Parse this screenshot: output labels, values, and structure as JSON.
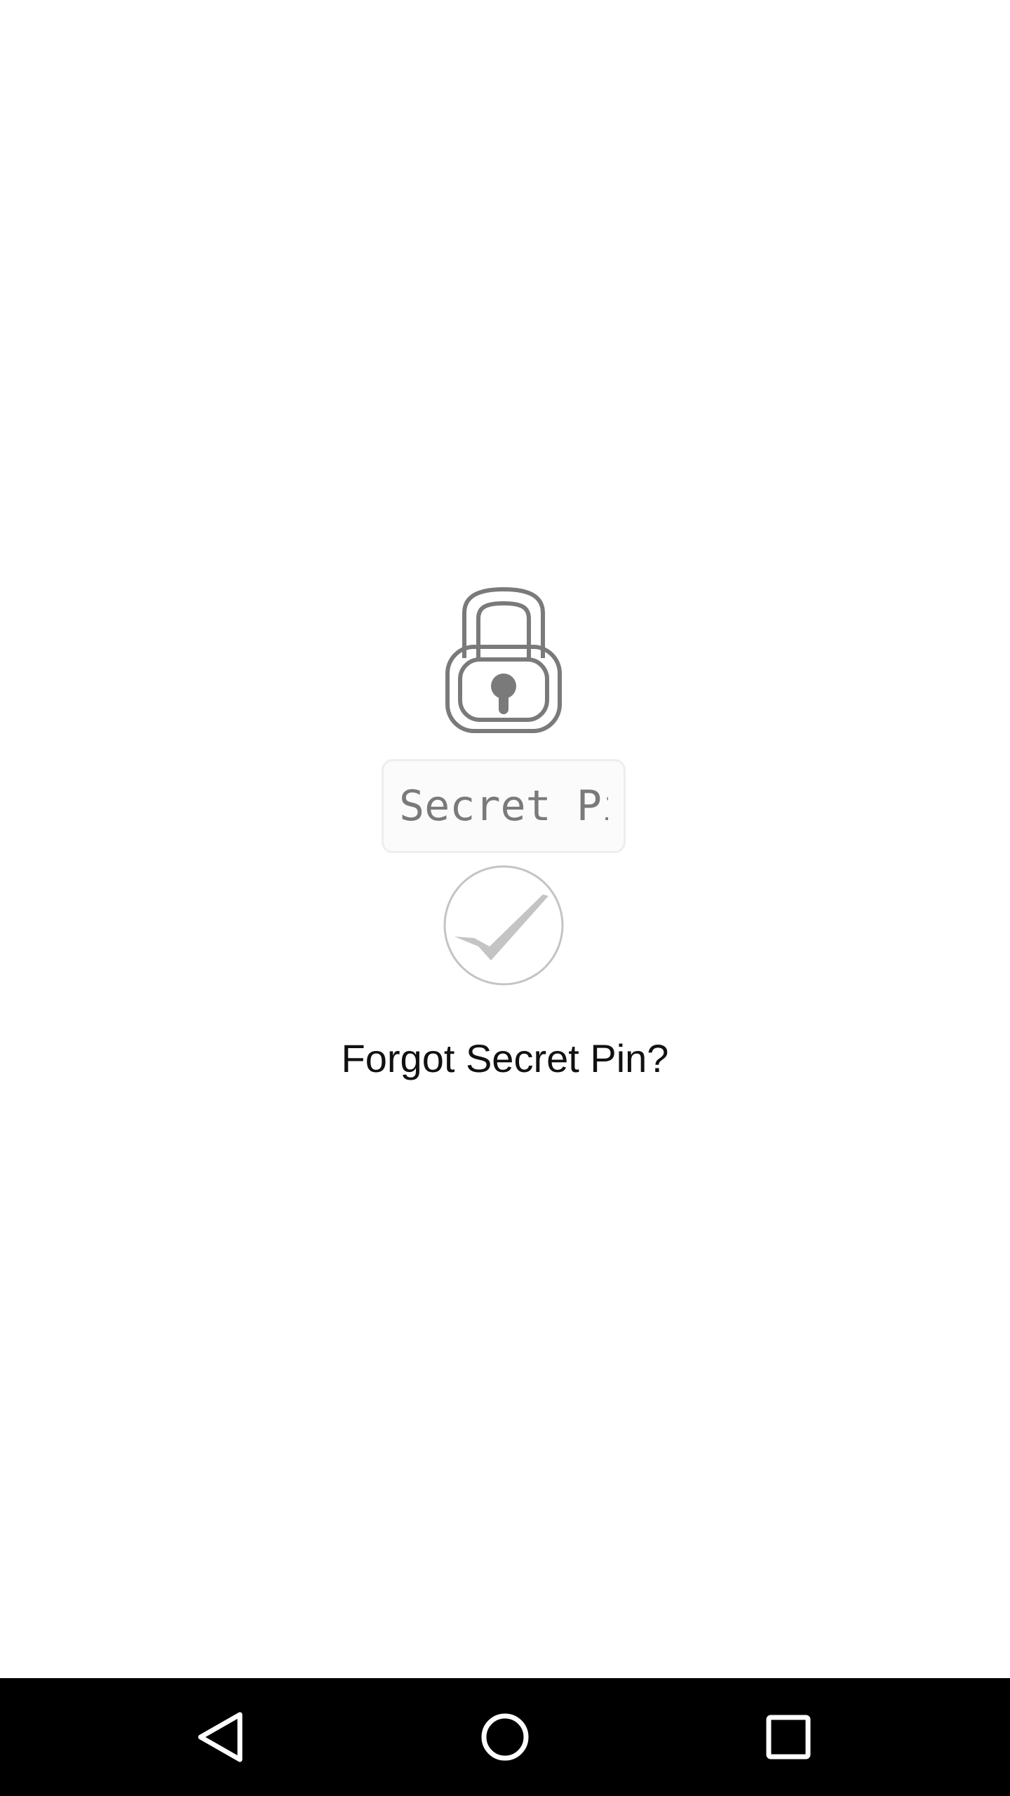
{
  "pin_form": {
    "placeholder": "Secret Pin",
    "value": ""
  },
  "forgot_link": {
    "label": "Forgot Secret Pin?"
  },
  "icons": {
    "lock": "lock-icon",
    "confirm": "checkmark-icon",
    "nav_back": "back-triangle-icon",
    "nav_home": "home-circle-icon",
    "nav_recents": "recents-square-icon"
  },
  "colors": {
    "background": "#ffffff",
    "lock_stroke": "#7a7a7a",
    "checkmark": "#c4c4c4",
    "nav_bar": "#000000",
    "nav_icon": "#ffffff"
  }
}
